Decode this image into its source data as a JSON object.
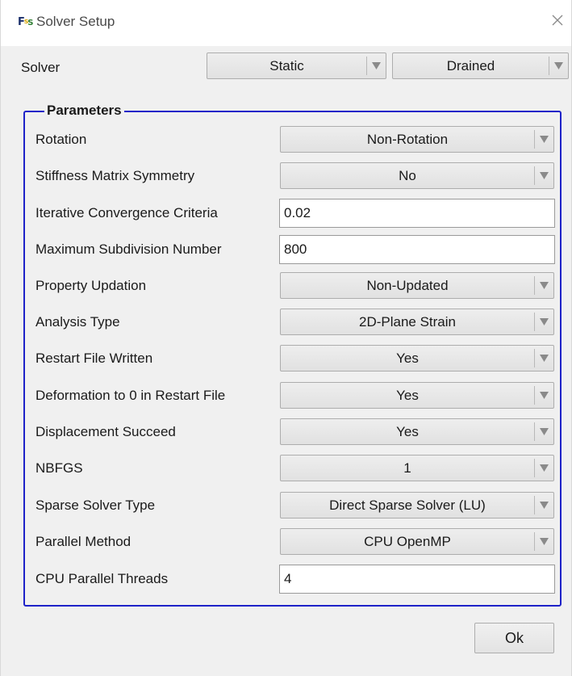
{
  "window": {
    "title": "Solver Setup",
    "app_icon": {
      "part1": "F",
      "part2": "s",
      "part3": "S"
    }
  },
  "solver": {
    "label": "Solver",
    "type_value": "Static",
    "drainage_value": "Drained"
  },
  "parameters": {
    "title": "Parameters",
    "rows": [
      {
        "label": "Rotation",
        "kind": "combo",
        "value": "Non-Rotation"
      },
      {
        "label": "Stiffness Matrix Symmetry",
        "kind": "combo",
        "value": "No"
      },
      {
        "label": "Iterative Convergence Criteria",
        "kind": "text",
        "value": "0.02"
      },
      {
        "label": "Maximum Subdivision Number",
        "kind": "text",
        "value": "800"
      },
      {
        "label": "Property Updation",
        "kind": "combo",
        "value": "Non-Updated"
      },
      {
        "label": "Analysis Type",
        "kind": "combo",
        "value": "2D-Plane Strain"
      },
      {
        "label": "Restart File Written",
        "kind": "combo",
        "value": "Yes"
      },
      {
        "label": "Deformation to 0 in Restart File",
        "kind": "combo",
        "value": "Yes"
      },
      {
        "label": "Displacement Succeed",
        "kind": "combo",
        "value": "Yes"
      },
      {
        "label": "NBFGS",
        "kind": "combo",
        "value": "1"
      },
      {
        "label": "Sparse Solver Type",
        "kind": "combo",
        "value": "Direct Sparse Solver (LU)"
      },
      {
        "label": "Parallel Method",
        "kind": "combo",
        "value": "CPU OpenMP"
      },
      {
        "label": "CPU Parallel Threads",
        "kind": "text",
        "value": "4"
      }
    ]
  },
  "footer": {
    "ok_label": "Ok"
  },
  "icons": {
    "close": "close-icon",
    "dropdown": "dropdown-arrow-icon",
    "app": "app-logo-icon"
  },
  "colors": {
    "group_border": "#1e22c8",
    "dialog_bg": "#f0f0f0",
    "titlebar_bg": "#ffffff",
    "combo_bg": "#e5e5e5",
    "arrow": "#8a8a8a"
  }
}
